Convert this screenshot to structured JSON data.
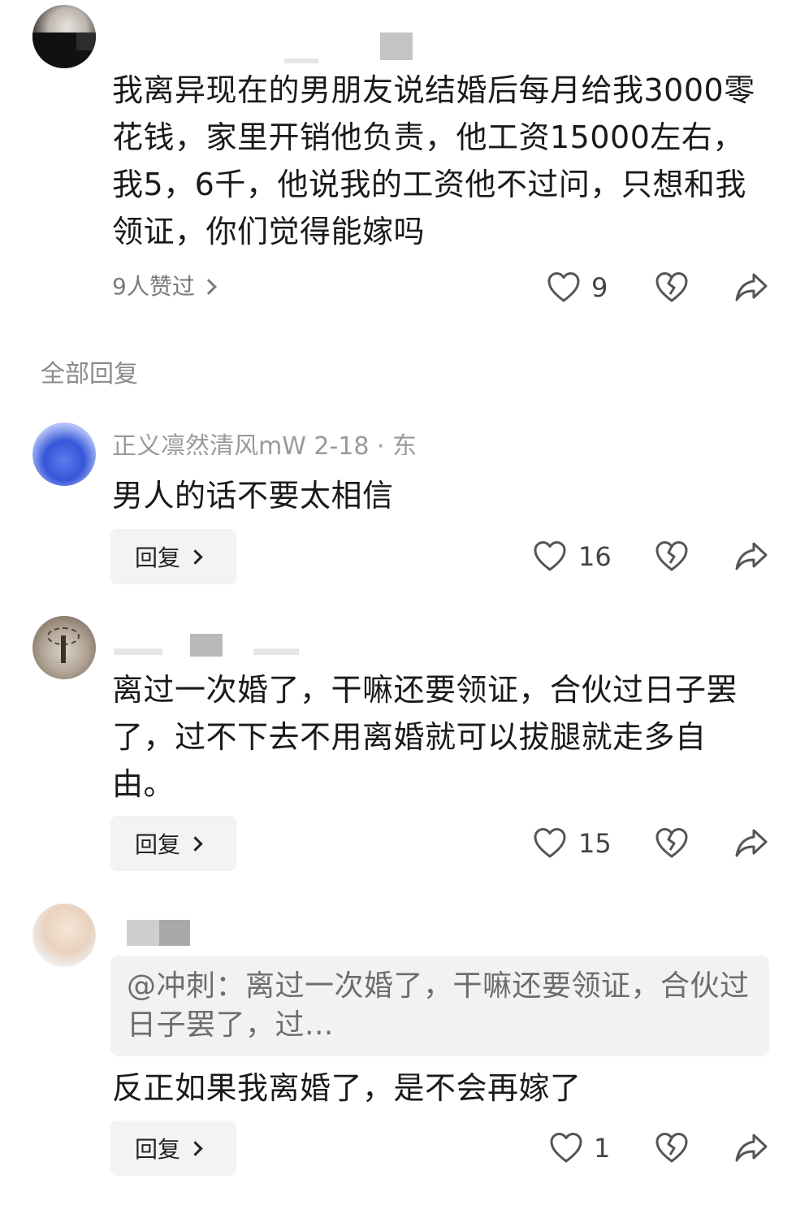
{
  "main_comment": {
    "text": "我离异现在的男朋友说结婚后每月给我3000零花钱，家里开销他负责，他工资15000左右，我5，6千，他说我的工资他不过问，只想和我领证，你们觉得能嫁吗",
    "likers_label": "9人赞过",
    "like_count": "9"
  },
  "section_title": "全部回复",
  "replies": [
    {
      "meta": "正义凛然清风mW  2-18  ·  东",
      "text": "男人的话不要太相信",
      "reply_label": "回复",
      "like_count": "16"
    },
    {
      "text": "离过一次婚了，干嘛还要领证，合伙过日子罢了，过不下去不用离婚就可以拔腿就走多自由。",
      "reply_label": "回复",
      "like_count": "15"
    },
    {
      "quote": "@冲刺：离过一次婚了，干嘛还要领证，合伙过日子罢了，过...",
      "text": "反正如果我离婚了，是不会再嫁了",
      "reply_label": "回复",
      "like_count": "1"
    }
  ],
  "icons": {
    "like": "heart-outline-icon",
    "dislike": "broken-heart-icon",
    "share": "share-arrow-icon"
  },
  "colors": {
    "text": "#1a1a1a",
    "muted": "#7a7a7a",
    "icon": "#555555",
    "button_bg": "#f3f3f3",
    "quote_bg": "#f2f2f2"
  }
}
